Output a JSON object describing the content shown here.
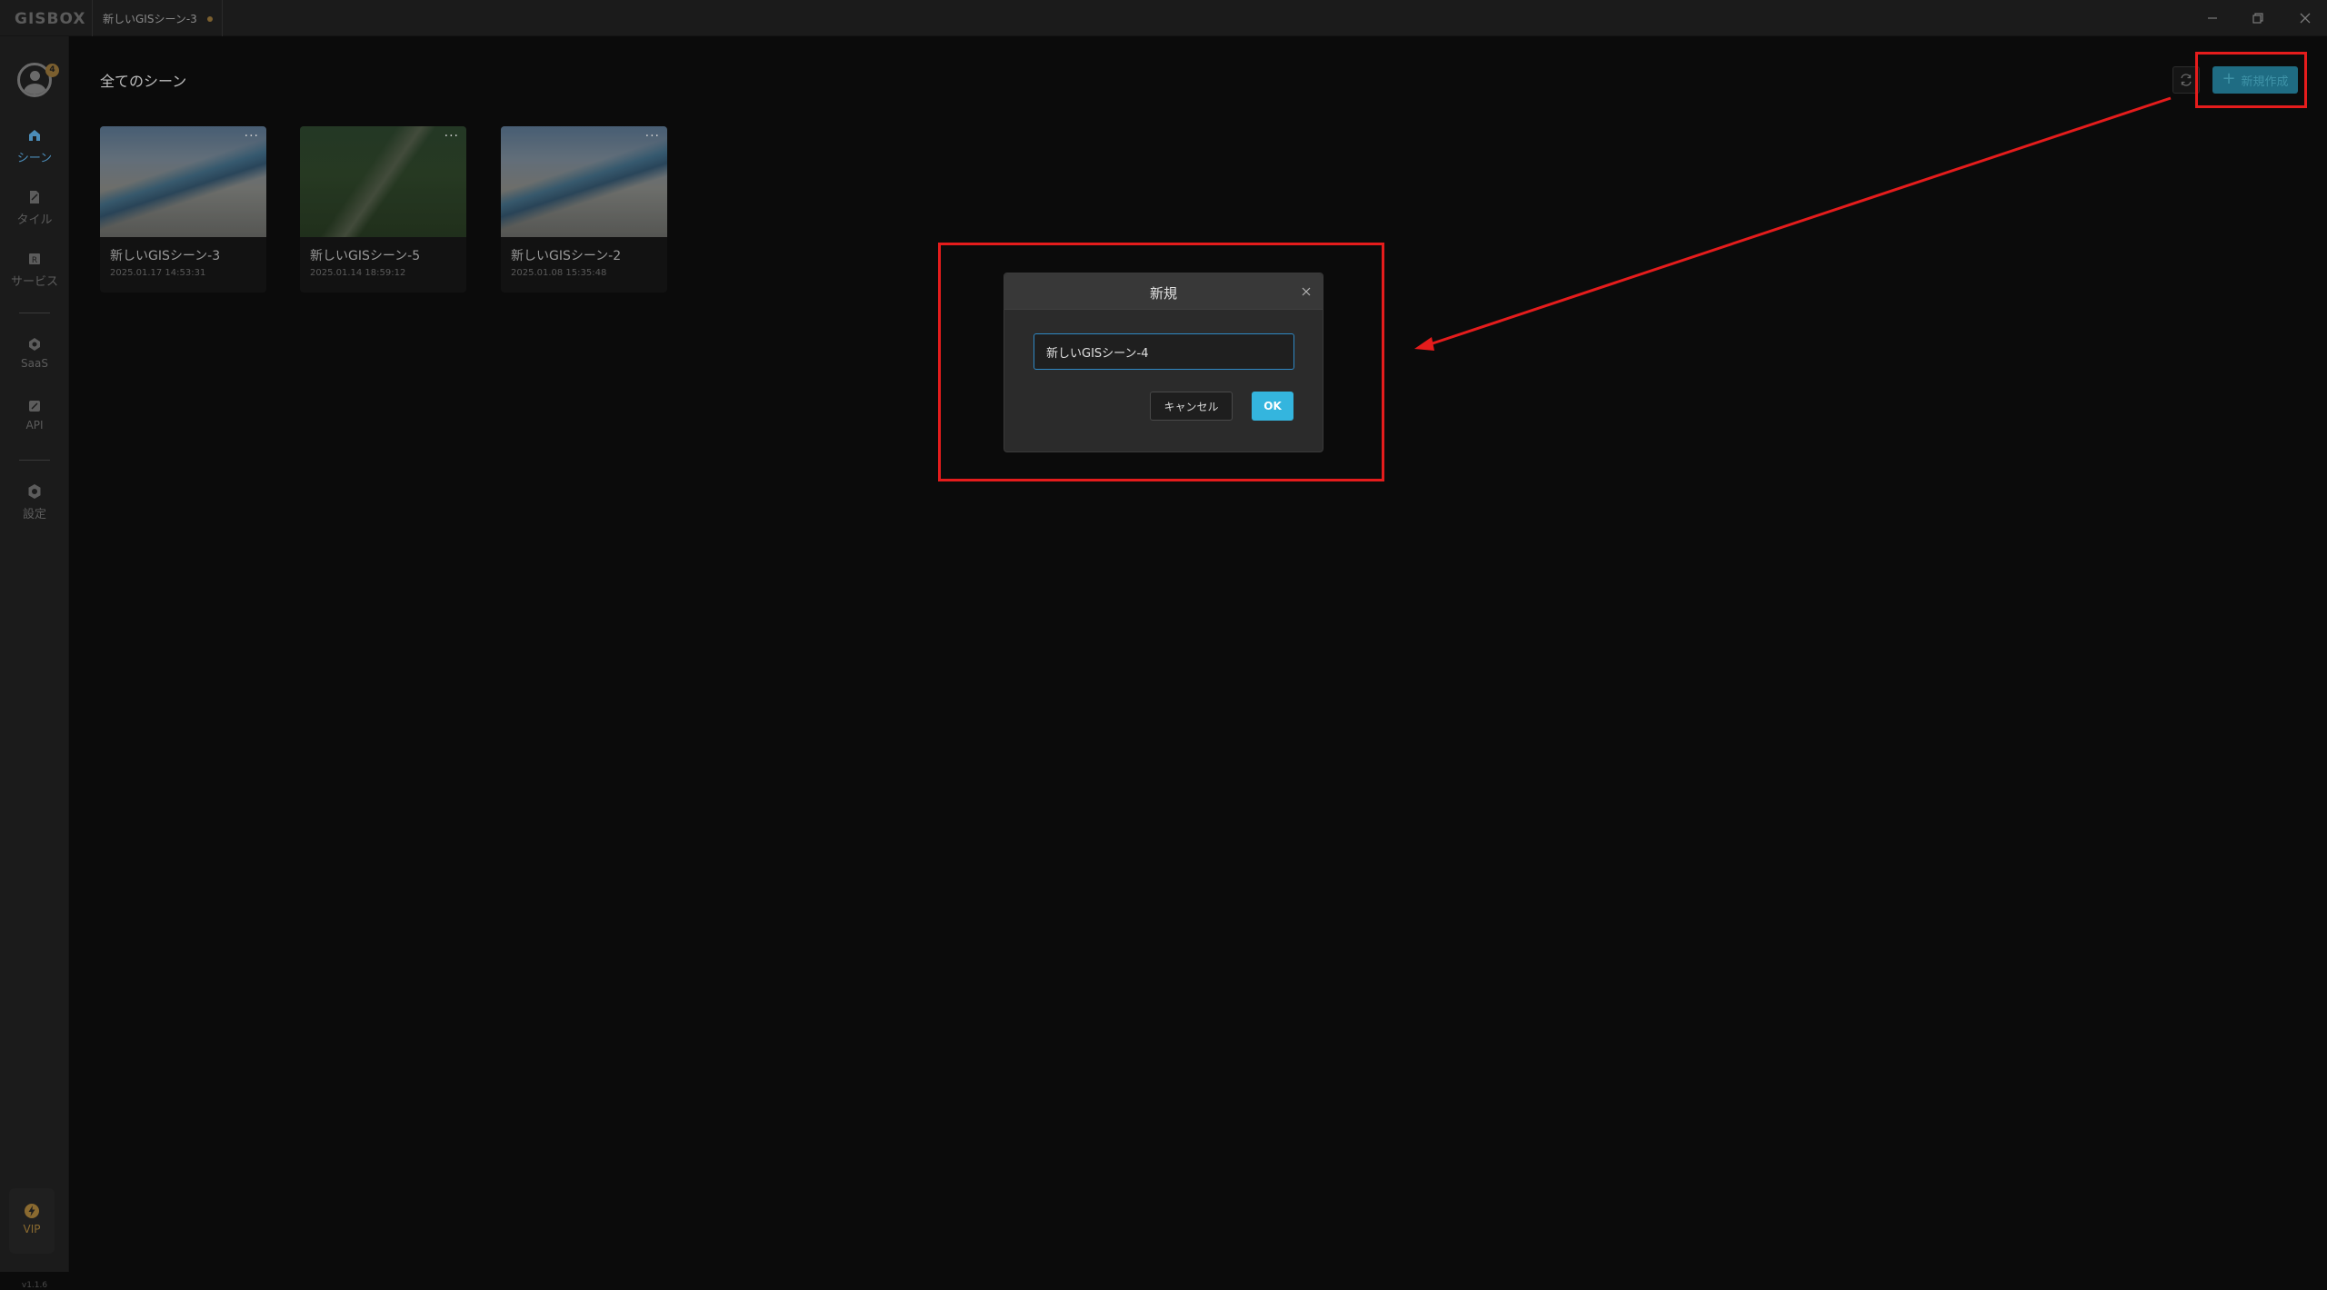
{
  "app": {
    "logo": "GISBOX",
    "tab_title": "新しいGISシーン-3"
  },
  "sidebar": {
    "avatar_badge": "4",
    "items": [
      {
        "label": "シーン",
        "icon": "scene-icon",
        "active": true
      },
      {
        "label": "タイル",
        "icon": "tile-icon"
      },
      {
        "label": "サービス",
        "icon": "service-icon"
      },
      {
        "label": "SaaS",
        "icon": "saas-icon"
      },
      {
        "label": "API",
        "icon": "api-icon"
      },
      {
        "label": "設定",
        "icon": "settings-icon"
      }
    ],
    "vip_label": "VIP",
    "version": "v1.1.6"
  },
  "main": {
    "title": "全てのシーン",
    "new_button_label": "新規作成",
    "scenes": [
      {
        "name": "新しいGISシーン-3",
        "date": "2025.01.17 14:53:31"
      },
      {
        "name": "新しいGISシーン-5",
        "date": "2025.01.14 18:59:12"
      },
      {
        "name": "新しいGISシーン-2",
        "date": "2025.01.08 15:35:48"
      }
    ]
  },
  "dialog": {
    "title": "新規",
    "input_value": "新しいGISシーン-4",
    "cancel_label": "キャンセル",
    "ok_label": "OK"
  },
  "colors": {
    "annotation": "#e51c1c",
    "accent": "#34b5de",
    "active_nav": "#4b8cb8"
  }
}
